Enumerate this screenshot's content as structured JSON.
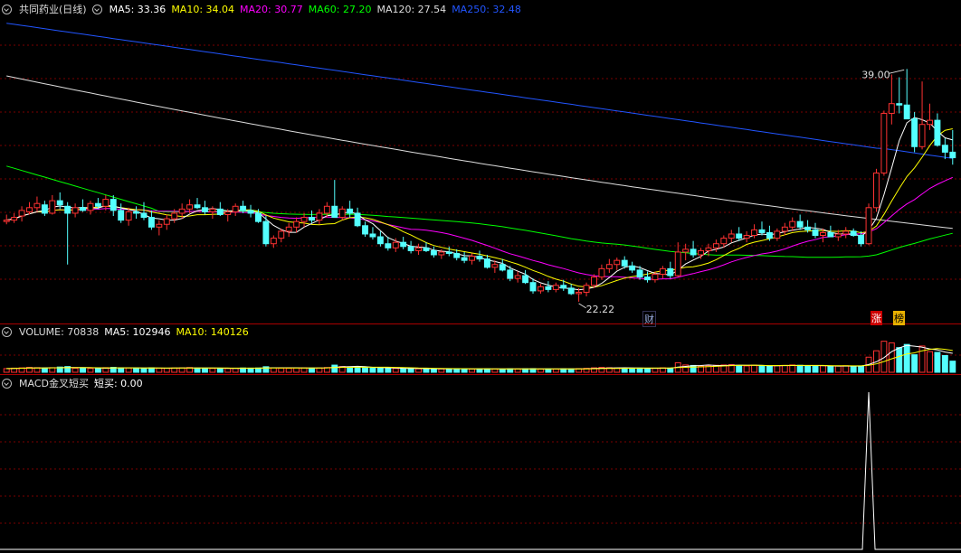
{
  "header": {
    "stock_title": "共同药业(日线)",
    "ma_labels": [
      {
        "text": "MA5: 33.36",
        "color": "#ffffff"
      },
      {
        "text": "MA10: 34.04",
        "color": "#ffff00"
      },
      {
        "text": "MA20: 30.77",
        "color": "#ff00ff"
      },
      {
        "text": "MA60: 27.20",
        "color": "#00ff00"
      },
      {
        "text": "MA120: 27.54",
        "color": "#dddddd"
      },
      {
        "text": "MA250: 32.48",
        "color": "#2255ff"
      }
    ]
  },
  "volume_header": {
    "title": "VOLUME: 70838",
    "ma5": "MA5: 102946",
    "ma10": "MA10: 140126"
  },
  "macd_header": {
    "title": "MACD金叉短买",
    "value": "短买: 0.00"
  },
  "annotations": {
    "high_label": "39.00",
    "low_label": "22.22",
    "cai_flag": "财",
    "zhang_flag": "涨",
    "bang_flag": "榜"
  },
  "colors": {
    "up": "#ff3232",
    "down": "#54ffff",
    "grid": "#7a0000",
    "ma5": "#ffffff",
    "ma10": "#ffff00",
    "ma20": "#ff00ff",
    "ma60": "#00ff00",
    "ma120": "#dddddd",
    "ma250": "#2255ff"
  },
  "chart_data": {
    "type": "candlestick",
    "price_range": [
      21.3,
      42.8
    ],
    "candles": [
      [
        28.0,
        28.5,
        27.8,
        28.1
      ],
      [
        28.1,
        28.6,
        27.9,
        28.3
      ],
      [
        28.4,
        29.1,
        28.0,
        28.8
      ],
      [
        28.7,
        29.4,
        28.5,
        29.0
      ],
      [
        29.0,
        29.8,
        28.7,
        29.3
      ],
      [
        29.2,
        29.5,
        28.4,
        28.6
      ],
      [
        28.6,
        29.9,
        28.5,
        29.5
      ],
      [
        29.5,
        30.1,
        28.9,
        29.2
      ],
      [
        29.1,
        29.4,
        24.9,
        28.6
      ],
      [
        28.6,
        29.3,
        28.3,
        29.0
      ],
      [
        29.0,
        29.6,
        28.7,
        28.8
      ],
      [
        28.8,
        29.5,
        28.5,
        29.3
      ],
      [
        29.3,
        29.7,
        28.9,
        29.1
      ],
      [
        29.1,
        29.9,
        28.8,
        29.6
      ],
      [
        29.6,
        29.9,
        28.4,
        28.8
      ],
      [
        28.8,
        29.3,
        27.9,
        28.1
      ],
      [
        28.1,
        29.0,
        27.7,
        28.7
      ],
      [
        28.7,
        29.1,
        28.2,
        28.6
      ],
      [
        28.6,
        29.4,
        28.1,
        28.3
      ],
      [
        28.3,
        28.8,
        27.4,
        27.6
      ],
      [
        27.6,
        28.1,
        27.0,
        27.8
      ],
      [
        27.8,
        28.5,
        27.4,
        28.2
      ],
      [
        28.2,
        28.9,
        27.9,
        28.6
      ],
      [
        28.6,
        29.3,
        28.2,
        28.9
      ],
      [
        28.9,
        29.6,
        28.6,
        29.2
      ],
      [
        29.2,
        29.7,
        28.9,
        29.0
      ],
      [
        29.0,
        29.5,
        28.5,
        28.7
      ],
      [
        28.7,
        29.1,
        28.2,
        28.9
      ],
      [
        28.9,
        29.4,
        28.4,
        28.5
      ],
      [
        28.5,
        28.9,
        28.0,
        28.7
      ],
      [
        28.7,
        29.3,
        28.4,
        29.1
      ],
      [
        29.1,
        29.5,
        28.6,
        28.8
      ],
      [
        28.8,
        29.2,
        28.3,
        28.6
      ],
      [
        28.6,
        28.9,
        27.9,
        28.0
      ],
      [
        28.0,
        28.4,
        26.2,
        26.4
      ],
      [
        26.4,
        27.0,
        26.1,
        26.8
      ],
      [
        26.8,
        27.5,
        26.5,
        27.3
      ],
      [
        27.3,
        27.9,
        26.9,
        27.6
      ],
      [
        27.6,
        28.3,
        27.2,
        28.0
      ],
      [
        28.0,
        28.6,
        27.6,
        28.3
      ],
      [
        28.3,
        28.8,
        27.9,
        28.1
      ],
      [
        28.1,
        28.9,
        27.8,
        28.6
      ],
      [
        28.6,
        29.4,
        28.3,
        29.1
      ],
      [
        29.1,
        31.0,
        28.5,
        28.3
      ],
      [
        28.3,
        29.1,
        28.1,
        28.9
      ],
      [
        28.9,
        29.5,
        28.3,
        28.6
      ],
      [
        28.6,
        29.0,
        27.6,
        27.7
      ],
      [
        27.7,
        28.0,
        26.9,
        27.1
      ],
      [
        27.1,
        27.6,
        26.7,
        26.9
      ],
      [
        26.9,
        27.3,
        26.2,
        26.4
      ],
      [
        26.4,
        26.9,
        25.9,
        26.1
      ],
      [
        26.1,
        26.8,
        25.8,
        26.5
      ],
      [
        26.5,
        26.9,
        26.0,
        26.2
      ],
      [
        26.2,
        26.6,
        25.7,
        25.9
      ],
      [
        25.9,
        26.4,
        25.6,
        26.1
      ],
      [
        26.1,
        26.5,
        25.8,
        25.9
      ],
      [
        25.9,
        26.2,
        25.4,
        25.6
      ],
      [
        25.6,
        26.0,
        25.3,
        25.8
      ],
      [
        25.8,
        26.2,
        25.5,
        25.7
      ],
      [
        25.7,
        26.0,
        25.2,
        25.4
      ],
      [
        25.4,
        25.8,
        25.0,
        25.2
      ],
      [
        25.2,
        25.7,
        24.9,
        25.5
      ],
      [
        25.5,
        25.9,
        25.1,
        25.3
      ],
      [
        25.3,
        25.6,
        24.6,
        24.7
      ],
      [
        24.7,
        25.2,
        24.3,
        24.9
      ],
      [
        24.9,
        25.3,
        24.4,
        24.5
      ],
      [
        24.5,
        24.8,
        23.7,
        23.9
      ],
      [
        23.9,
        24.4,
        23.6,
        24.1
      ],
      [
        24.1,
        24.5,
        23.5,
        23.6
      ],
      [
        23.6,
        23.9,
        22.8,
        23.0
      ],
      [
        23.0,
        23.5,
        22.8,
        23.3
      ],
      [
        23.3,
        23.7,
        22.9,
        23.1
      ],
      [
        23.1,
        23.6,
        22.9,
        23.4
      ],
      [
        23.4,
        23.8,
        23.0,
        23.2
      ],
      [
        23.2,
        23.5,
        22.7,
        22.8
      ],
      [
        22.8,
        23.2,
        22.22,
        22.9
      ],
      [
        22.9,
        23.6,
        22.6,
        23.4
      ],
      [
        23.4,
        24.2,
        23.2,
        24.0
      ],
      [
        24.0,
        24.9,
        23.8,
        24.6
      ],
      [
        24.6,
        25.3,
        24.3,
        24.9
      ],
      [
        24.9,
        25.4,
        24.5,
        25.2
      ],
      [
        25.2,
        25.5,
        24.6,
        24.8
      ],
      [
        24.8,
        25.1,
        24.3,
        24.5
      ],
      [
        24.5,
        24.8,
        23.8,
        24.0
      ],
      [
        24.0,
        24.4,
        23.6,
        23.8
      ],
      [
        23.8,
        24.4,
        23.6,
        24.2
      ],
      [
        24.2,
        24.8,
        23.9,
        24.6
      ],
      [
        24.6,
        25.1,
        23.9,
        24.1
      ],
      [
        24.1,
        26.5,
        24.0,
        25.8
      ],
      [
        25.8,
        26.4,
        25.2,
        26.0
      ],
      [
        26.0,
        26.6,
        25.4,
        25.6
      ],
      [
        25.6,
        26.1,
        25.3,
        25.9
      ],
      [
        25.9,
        26.4,
        25.5,
        26.1
      ],
      [
        26.1,
        26.7,
        25.8,
        26.4
      ],
      [
        26.4,
        27.0,
        26.1,
        26.8
      ],
      [
        26.8,
        27.4,
        26.5,
        27.1
      ],
      [
        27.1,
        27.6,
        26.6,
        26.8
      ],
      [
        26.8,
        27.3,
        26.5,
        27.0
      ],
      [
        27.0,
        27.8,
        26.8,
        27.4
      ],
      [
        27.4,
        28.0,
        27.0,
        27.2
      ],
      [
        27.2,
        27.7,
        26.6,
        26.8
      ],
      [
        26.8,
        27.5,
        26.6,
        27.3
      ],
      [
        27.3,
        27.9,
        27.0,
        27.6
      ],
      [
        27.6,
        28.3,
        27.3,
        28.0
      ],
      [
        28.0,
        28.5,
        27.4,
        27.6
      ],
      [
        27.6,
        28.1,
        27.2,
        27.4
      ],
      [
        27.4,
        27.9,
        26.8,
        27.0
      ],
      [
        27.0,
        27.5,
        26.5,
        27.2
      ],
      [
        27.2,
        27.7,
        26.9,
        26.9
      ],
      [
        26.9,
        27.4,
        26.6,
        27.1
      ],
      [
        27.1,
        27.6,
        26.8,
        27.3
      ],
      [
        27.3,
        27.5,
        26.9,
        27.0
      ],
      [
        27.0,
        27.3,
        26.2,
        26.4
      ],
      [
        26.4,
        29.3,
        26.3,
        29.0
      ],
      [
        29.0,
        31.8,
        28.7,
        31.5
      ],
      [
        31.5,
        36.0,
        31.3,
        35.8
      ],
      [
        35.8,
        38.6,
        35.0,
        36.5
      ],
      [
        36.5,
        38.4,
        35.8,
        36.4
      ],
      [
        36.4,
        39.0,
        35.9,
        35.4
      ],
      [
        35.4,
        35.9,
        33.0,
        33.4
      ],
      [
        33.4,
        38.1,
        33.2,
        35.0
      ],
      [
        35.0,
        36.5,
        34.6,
        35.3
      ],
      [
        35.3,
        35.8,
        33.4,
        33.5
      ],
      [
        33.5,
        34.0,
        32.5,
        33.0
      ],
      [
        33.0,
        34.6,
        32.1,
        32.6
      ]
    ],
    "volume_scale_max": 21000,
    "volume": [
      2300,
      2600,
      2800,
      3100,
      2900,
      2500,
      2900,
      3300,
      3600,
      2500,
      2600,
      2400,
      2500,
      2900,
      3100,
      2800,
      2700,
      2500,
      2500,
      2800,
      2600,
      2500,
      2700,
      2800,
      3000,
      2600,
      2500,
      2400,
      2500,
      2400,
      2500,
      2700,
      2600,
      2700,
      3500,
      2800,
      2600,
      2500,
      2700,
      2800,
      2600,
      2700,
      3000,
      4500,
      3600,
      3200,
      3300,
      3000,
      2600,
      2700,
      2500,
      2400,
      2300,
      2400,
      2200,
      2300,
      2200,
      2100,
      2200,
      2300,
      2200,
      2000,
      2100,
      2200,
      2100,
      2000,
      2200,
      2100,
      2200,
      2300,
      2000,
      2100,
      2000,
      2200,
      2100,
      2300,
      2500,
      2800,
      3100,
      2900,
      2700,
      2600,
      2500,
      2600,
      2400,
      2500,
      2800,
      2600,
      6000,
      4600,
      4300,
      3900,
      4100,
      4400,
      4600,
      4800,
      4200,
      4000,
      4400,
      4300,
      3900,
      4100,
      4300,
      4600,
      4400,
      4000,
      3900,
      4100,
      3700,
      3900,
      4100,
      3800,
      4000,
      9500,
      13500,
      19500,
      18500,
      15500,
      17500,
      11000,
      16500,
      13000,
      12500,
      10500,
      7000
    ],
    "vol_ma5": [
      2300,
      2450,
      2560,
      2700,
      2740,
      2780,
      2840,
      2900,
      3040,
      2960,
      2980,
      2880,
      2720,
      2580,
      2700,
      2760,
      2800,
      2800,
      2720,
      2660,
      2620,
      2580,
      2620,
      2640,
      2720,
      2720,
      2720,
      2660,
      2600,
      2480,
      2460,
      2500,
      2540,
      2580,
      2800,
      2860,
      2840,
      2820,
      2820,
      2680,
      2640,
      2660,
      2760,
      3120,
      3440,
      3600,
      3720,
      3520,
      3140,
      2960,
      2820,
      2640,
      2500,
      2460,
      2360,
      2320,
      2280,
      2240,
      2200,
      2220,
      2200,
      2160,
      2160,
      2160,
      2120,
      2080,
      2120,
      2120,
      2120,
      2160,
      2160,
      2180,
      2120,
      2140,
      2140,
      2140,
      2220,
      2380,
      2560,
      2720,
      2800,
      2820,
      2760,
      2660,
      2560,
      2520,
      2560,
      2580,
      3260,
      3700,
      4060,
      4280,
      4580,
      4260,
      4260,
      4360,
      4480,
      4400,
      4360,
      4340,
      4160,
      4140,
      4200,
      4260,
      4260,
      4280,
      4260,
      4200,
      4020,
      3920,
      3940,
      3920,
      3900,
      4860,
      6560,
      9200,
      12940,
      15300,
      16900,
      16400,
      15800,
      14700,
      14100,
      12700,
      11900
    ],
    "vol_ma10": [
      2300,
      2450,
      2570,
      2700,
      2740,
      2750,
      2780,
      2830,
      2910,
      2870,
      2900,
      2880,
      2840,
      2780,
      2800,
      2800,
      2780,
      2760,
      2740,
      2770,
      2720,
      2710,
      2700,
      2690,
      2700,
      2700,
      2700,
      2690,
      2680,
      2640,
      2610,
      2610,
      2620,
      2620,
      2660,
      2680,
      2680,
      2680,
      2700,
      2720,
      2740,
      2750,
      2780,
      2950,
      3040,
      3110,
      3180,
      3200,
      3190,
      3180,
      3170,
      3080,
      2970,
      2820,
      2690,
      2600,
      2500,
      2420,
      2340,
      2290,
      2260,
      2230,
      2210,
      2200,
      2180,
      2150,
      2150,
      2140,
      2140,
      2150,
      2140,
      2140,
      2130,
      2140,
      2140,
      2150,
      2180,
      2240,
      2330,
      2390,
      2450,
      2500,
      2550,
      2600,
      2640,
      2640,
      2670,
      2680,
      2990,
      3110,
      3290,
      3420,
      3580,
      3760,
      3980,
      4200,
      4370,
      4390,
      4470,
      4300,
      4210,
      4270,
      4300,
      4290,
      4300,
      4340,
      4330,
      4310,
      4170,
      4110,
      4070,
      4050,
      4030,
      4420,
      5290,
      6770,
      8450,
      9990,
      11500,
      12180,
      13500,
      14400,
      14900,
      14400,
      13700
    ],
    "macd_signal": {
      "index": 113,
      "value": 1.0
    },
    "high_point": {
      "index": 118,
      "value": 39.0
    },
    "low_point": {
      "index": 75,
      "value": 22.22
    }
  }
}
